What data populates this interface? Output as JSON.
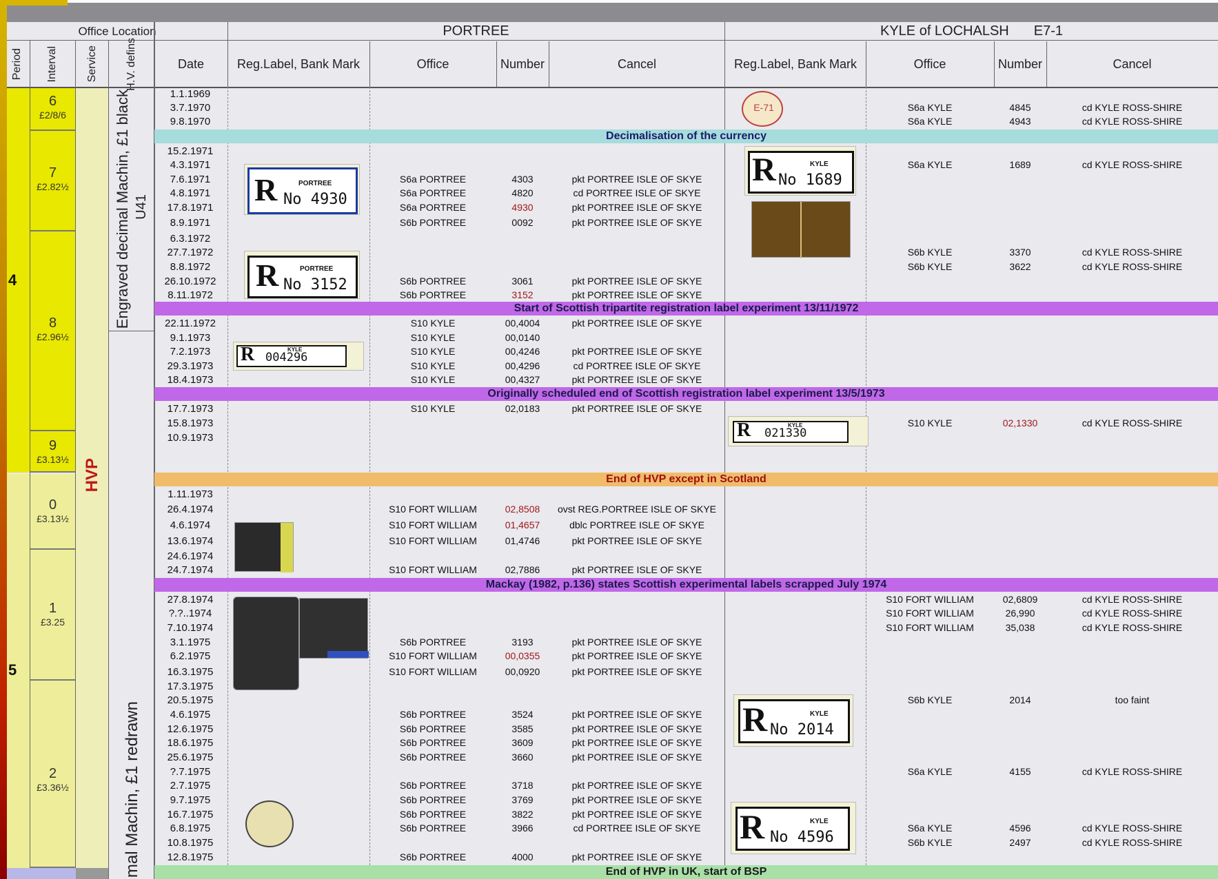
{
  "header": {
    "office_location": "Office Location",
    "portree": "PORTREE",
    "kyle": "KYLE of LOCHALSH",
    "kyle_code": "E7-1",
    "period": "Period",
    "interval": "Interval",
    "service": "Service",
    "hv_defins": "H.V. defins",
    "date": "Date",
    "reg_label": "Reg.Label, Bank Mark",
    "office": "Office",
    "number": "Number",
    "cancel": "Cancel"
  },
  "periods": [
    "4",
    "5"
  ],
  "intervals": [
    {
      "n": "6",
      "price": "£2/8/6"
    },
    {
      "n": "7",
      "price": "£2.82½"
    },
    {
      "n": "8",
      "price": "£2.96½"
    },
    {
      "n": "9",
      "price": "£3.13½"
    },
    {
      "n": "0",
      "price": "£3.13½"
    },
    {
      "n": "1",
      "price": "£3.25"
    },
    {
      "n": "2",
      "price": "£3.36½"
    }
  ],
  "service": {
    "hvp": "HVP"
  },
  "hv_defins": {
    "machin1": "Engraved decimal Machin, £1 black",
    "u41": "U41",
    "machin2": "mal Machin, £1 redrawn"
  },
  "banners": {
    "decimalisation": "Decimalisation of the currency",
    "tripartite": "Start of Scottish tripartite registration label experiment 13/11/1972",
    "scheduled_end": "Originally scheduled end of Scottish registration label experiment 13/5/1973",
    "hvp_end": "End of HVP except in Scotland",
    "mackay": "Mackay (1982, p.136) states Scottish experimental labels scrapped July 1974",
    "bsp": "End of HVP in UK, start of BSP"
  },
  "dates": [
    "1.1.1969",
    "3.7.1970",
    "9.8.1970",
    "15.2.1971",
    "4.3.1971",
    "7.6.1971",
    "4.8.1971",
    "17.8.1971",
    "8.9.1971",
    "6.3.1972",
    "27.7.1972",
    "8.8.1972",
    "26.10.1972",
    "8.11.1972",
    "22.11.1972",
    "9.1.1973",
    "7.2.1973",
    "29.3.1973",
    "18.4.1973",
    "17.7.1973",
    "15.8.1973",
    "10.9.1973",
    "1.11.1973",
    "26.4.1974",
    "4.6.1974",
    "13.6.1974",
    "24.6.1974",
    "24.7.1974",
    "27.8.1974",
    "?.?..1974",
    "7.10.1974",
    "3.1.1975",
    "6.2.1975",
    "16.3.1975",
    "17.3.1975",
    "20.5.1975",
    "4.6.1975",
    "12.6.1975",
    "18.6.1975",
    "25.6.1975",
    "?.7.1975",
    "2.7.1975",
    "9.7.1975",
    "16.7.1975",
    "6.8.1975",
    "10.8.1975",
    "12.8.1975"
  ],
  "portree_rows": [
    {
      "office": "S6a PORTREE",
      "number": "4303",
      "cancel": "pkt PORTREE ISLE OF SKYE"
    },
    {
      "office": "S6a PORTREE",
      "number": "4820",
      "cancel": "cd PORTREE ISLE OF SKYE"
    },
    {
      "office": "S6a PORTREE",
      "number": "4930",
      "cancel": "pkt PORTREE ISLE OF SKYE",
      "red": true
    },
    {
      "office": "S6b PORTREE",
      "number": "0092",
      "cancel": "pkt PORTREE ISLE OF SKYE"
    },
    {
      "office": "S6b PORTREE",
      "number": "3061",
      "cancel": "pkt PORTREE ISLE OF SKYE"
    },
    {
      "office": "S6b PORTREE",
      "number": "3152",
      "cancel": "pkt PORTREE ISLE OF SKYE",
      "red": true
    },
    {
      "office": "S10 KYLE",
      "number": "00,4004",
      "cancel": "pkt PORTREE ISLE OF SKYE"
    },
    {
      "office": "S10 KYLE",
      "number": "00,0140",
      "cancel": ""
    },
    {
      "office": "S10 KYLE",
      "number": "00,4246",
      "cancel": "pkt PORTREE ISLE OF SKYE"
    },
    {
      "office": "S10 KYLE",
      "number": "00,4296",
      "cancel": "cd PORTREE ISLE OF SKYE"
    },
    {
      "office": "S10 KYLE",
      "number": "00,4327",
      "cancel": "pkt PORTREE ISLE OF SKYE"
    },
    {
      "office": "S10 KYLE",
      "number": "02,0183",
      "cancel": "pkt PORTREE ISLE OF SKYE"
    },
    {
      "office": "S10 FORT WILLIAM",
      "number": "02,8508",
      "cancel": "ovst REG.PORTREE ISLE OF SKYE",
      "red": true
    },
    {
      "office": "S10 FORT WILLIAM",
      "number": "01,4657",
      "cancel": "dblc PORTREE ISLE OF SKYE",
      "red": true
    },
    {
      "office": "S10 FORT WILLIAM",
      "number": "01,4746",
      "cancel": "pkt PORTREE ISLE OF SKYE"
    },
    {
      "office": "S10 FORT WILLIAM",
      "number": "02,7886",
      "cancel": "pkt PORTREE ISLE OF SKYE"
    },
    {
      "office": "S6b PORTREE",
      "number": "3193",
      "cancel": "pkt PORTREE ISLE OF SKYE"
    },
    {
      "office": "S10 FORT WILLIAM",
      "number": "00,0355",
      "cancel": "pkt PORTREE ISLE OF SKYE",
      "red": true
    },
    {
      "office": "S10 FORT WILLIAM",
      "number": "00,0920",
      "cancel": "pkt PORTREE ISLE OF SKYE"
    },
    {
      "office": "S6b PORTREE",
      "number": "3524",
      "cancel": "pkt PORTREE ISLE OF SKYE"
    },
    {
      "office": "S6b PORTREE",
      "number": "3585",
      "cancel": "pkt PORTREE ISLE OF SKYE"
    },
    {
      "office": "S6b PORTREE",
      "number": "3609",
      "cancel": "pkt PORTREE ISLE OF SKYE"
    },
    {
      "office": "S6b PORTREE",
      "number": "3660",
      "cancel": "pkt PORTREE ISLE OF SKYE"
    },
    {
      "office": "S6b PORTREE",
      "number": "3718",
      "cancel": "pkt PORTREE ISLE OF SKYE"
    },
    {
      "office": "S6b PORTREE",
      "number": "3769",
      "cancel": "pkt PORTREE ISLE OF SKYE"
    },
    {
      "office": "S6b PORTREE",
      "number": "3822",
      "cancel": "pkt PORTREE ISLE OF SKYE"
    },
    {
      "office": "S6b PORTREE",
      "number": "3966",
      "cancel": "cd PORTREE ISLE OF SKYE"
    },
    {
      "office": "S6b PORTREE",
      "number": "4000",
      "cancel": "pkt PORTREE ISLE OF SKYE"
    }
  ],
  "kyle_rows": [
    {
      "office": "S6a KYLE",
      "number": "4845",
      "cancel": "cd KYLE ROSS-SHIRE"
    },
    {
      "office": "S6a KYLE",
      "number": "4943",
      "cancel": "cd KYLE ROSS-SHIRE"
    },
    {
      "office": "S6a KYLE",
      "number": "1689",
      "cancel": "cd KYLE ROSS-SHIRE"
    },
    {
      "office": "S6b KYLE",
      "number": "3370",
      "cancel": "cd KYLE ROSS-SHIRE"
    },
    {
      "office": "S6b KYLE",
      "number": "3622",
      "cancel": "cd KYLE ROSS-SHIRE"
    },
    {
      "office": "S10 KYLE",
      "number": "02,1330",
      "cancel": "cd KYLE ROSS-SHIRE",
      "red": true
    },
    {
      "office": "S10 FORT WILLIAM",
      "number": "02,6809",
      "cancel": "cd KYLE ROSS-SHIRE"
    },
    {
      "office": "S10 FORT WILLIAM",
      "number": "26,990",
      "cancel": "cd KYLE ROSS-SHIRE"
    },
    {
      "office": "S10 FORT WILLIAM",
      "number": "35,038",
      "cancel": "cd KYLE ROSS-SHIRE"
    },
    {
      "office": "S6b KYLE",
      "number": "2014",
      "cancel": "too faint"
    },
    {
      "office": "S6a KYLE",
      "number": "4155",
      "cancel": "cd KYLE ROSS-SHIRE"
    },
    {
      "office": "S6a KYLE",
      "number": "4596",
      "cancel": "cd KYLE ROSS-SHIRE"
    },
    {
      "office": "S6b KYLE",
      "number": "2497",
      "cancel": "cd KYLE ROSS-SHIRE"
    }
  ],
  "labels": {
    "portree_4930": {
      "town": "PORTREE",
      "no": "No 4930"
    },
    "portree_3152": {
      "town": "PORTREE",
      "no": "No 3152"
    },
    "kyle_004296": {
      "town": "KYLE",
      "no": "004296"
    },
    "e71": "E-71",
    "kyle_1689": {
      "town": "KYLE",
      "no": "No 1689"
    },
    "kyle_021330": {
      "town": "KYLE",
      "no": "021330"
    },
    "kyle_2014": {
      "town": "KYLE",
      "no": "No 2014"
    },
    "kyle_4596": {
      "town": "KYLE",
      "no": "No 4596"
    }
  },
  "colors": {
    "period_yellow": "#e8e800",
    "banner_purple": "#c068e8",
    "banner_cyan": "#a6dcdc",
    "banner_orange": "#f0bc6a",
    "banner_green": "#a8e0a8",
    "number_red": "#a01818"
  }
}
